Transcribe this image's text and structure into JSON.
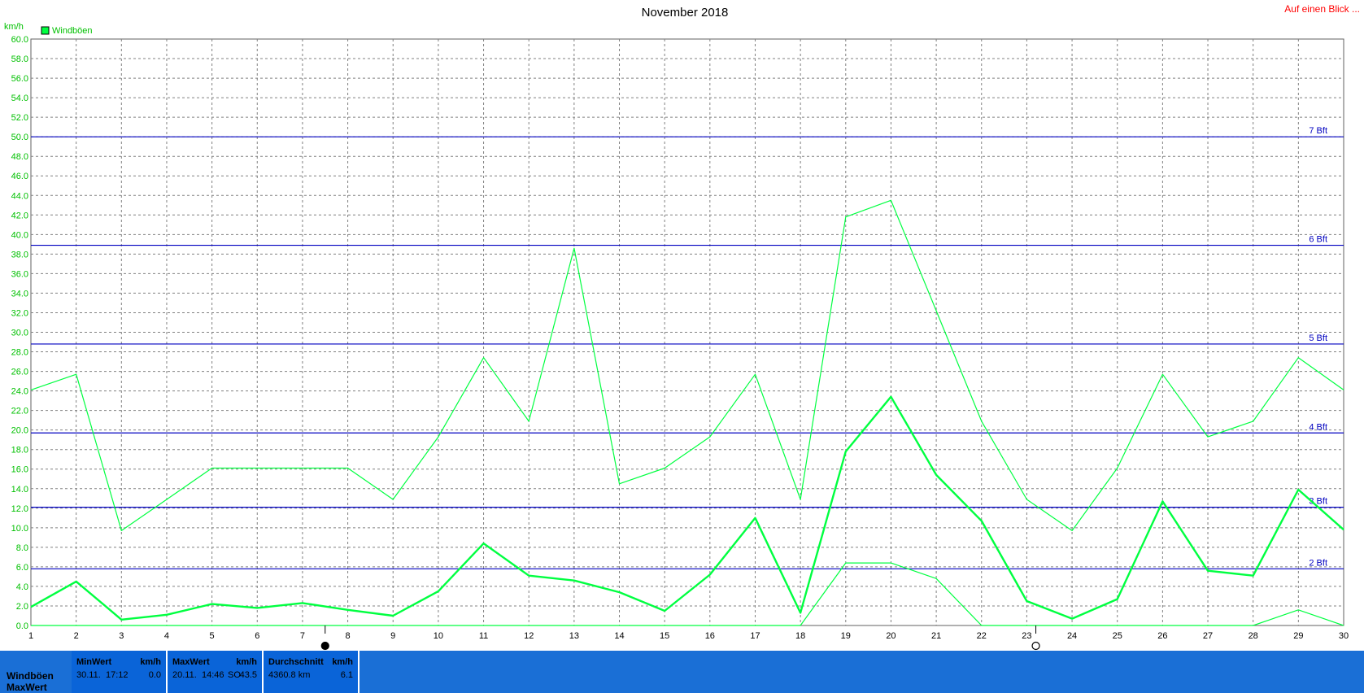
{
  "header": {
    "title": "November 2018",
    "link_label": "Auf einen Blick ..."
  },
  "colors": {
    "series": "#00ff40",
    "grid": "#808080",
    "beaufort_line": "#0000c0",
    "panel": "#0a64d8"
  },
  "chart_data": {
    "type": "line",
    "ylabel": "km/h",
    "ylim": [
      0,
      60
    ],
    "ytick_step": 2,
    "xlim": [
      1,
      30
    ],
    "x": [
      1,
      2,
      3,
      4,
      5,
      6,
      7,
      8,
      9,
      10,
      11,
      12,
      13,
      14,
      15,
      16,
      17,
      18,
      19,
      20,
      21,
      22,
      23,
      24,
      25,
      26,
      27,
      28,
      29,
      30
    ],
    "legend": [
      "Windböen"
    ],
    "legend_position": "top-left",
    "grid": true,
    "series": [
      {
        "name": "Windböen",
        "role": "max",
        "values": [
          24.1,
          25.7,
          9.7,
          12.9,
          16.1,
          16.1,
          16.1,
          16.1,
          12.9,
          19.3,
          27.4,
          20.9,
          38.6,
          14.5,
          16.1,
          19.3,
          25.7,
          12.9,
          41.8,
          43.5,
          32.2,
          20.9,
          12.9,
          9.7,
          16.1,
          25.7,
          19.3,
          20.9,
          27.4,
          24.1
        ]
      },
      {
        "name": "Windböen",
        "role": "avg",
        "values": [
          1.9,
          4.5,
          0.6,
          1.1,
          2.2,
          1.8,
          2.3,
          1.6,
          1.0,
          3.5,
          8.4,
          5.1,
          4.6,
          3.4,
          1.5,
          5.2,
          11.0,
          1.3,
          17.8,
          23.4,
          15.4,
          10.7,
          2.5,
          0.7,
          2.7,
          12.7,
          5.6,
          5.1,
          13.9,
          9.8
        ]
      },
      {
        "name": "Windböen",
        "role": "min",
        "values": [
          0,
          0,
          0,
          0,
          0,
          0,
          0,
          0,
          0,
          0,
          0,
          0,
          0,
          0,
          0,
          0,
          0,
          0,
          6.4,
          6.4,
          4.8,
          0,
          0,
          0,
          0,
          0,
          0,
          0,
          1.6,
          0
        ]
      }
    ],
    "beaufort_lines": [
      {
        "label": "2 Bft",
        "value": 5.8
      },
      {
        "label": "3 Bft",
        "value": 12.1
      },
      {
        "label": "4 Bft",
        "value": 19.7
      },
      {
        "label": "5 Bft",
        "value": 28.8
      },
      {
        "label": "6 Bft",
        "value": 38.9
      },
      {
        "label": "7 Bft",
        "value": 50.0
      }
    ],
    "moon_phases": [
      {
        "day": 7.5,
        "phase": "full"
      },
      {
        "day": 23.2,
        "phase": "new"
      }
    ]
  },
  "stats": {
    "row_label": "Windböen",
    "row_sublabel": "MaxWert",
    "min": {
      "header": "MinWert",
      "unit": "km/h",
      "date": "30.11.",
      "time": "17:12",
      "value": "0.0"
    },
    "max": {
      "header": "MaxWert",
      "unit": "km/h",
      "date": "20.11.",
      "time": "14:46",
      "dir": "SO",
      "value": "43.5"
    },
    "avg": {
      "header": "Durchschnitt",
      "unit": "km/h",
      "distance": "4360.8 km",
      "value": "6.1"
    }
  }
}
